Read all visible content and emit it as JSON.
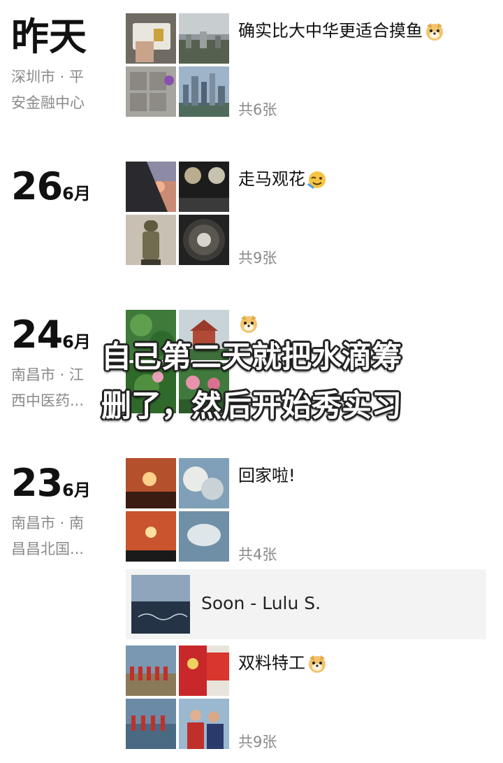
{
  "entries": [
    {
      "date_label": "昨天",
      "location_line1": "深圳市 · 平",
      "location_line2": "安金融中心",
      "caption": "确实比大中华更适合摸鱼",
      "caption_emoji": "doge-emoji",
      "count": "共6张"
    },
    {
      "day": "26",
      "month": "6月",
      "caption": "走马观花",
      "caption_emoji": "wink-emoji",
      "count": "共9张"
    },
    {
      "day": "24",
      "month": "6月",
      "location_line1": "南昌市 · 江",
      "location_line2": "西中医药...",
      "caption_emoji": "doge-emoji"
    },
    {
      "day": "23",
      "month": "6月",
      "location_line1": "南昌市 · 南",
      "location_line2": "昌昌北国...",
      "caption": "回家啦!",
      "count": "共4张",
      "music_title": "Soon - Lulu S.",
      "post2_caption": "双料特工",
      "post2_emoji": "doge-emoji",
      "post2_count": "共9张"
    }
  ],
  "overlay": {
    "line1": "自己第二天就把水滴筹",
    "line2": "删了，然后开始秀实习"
  }
}
